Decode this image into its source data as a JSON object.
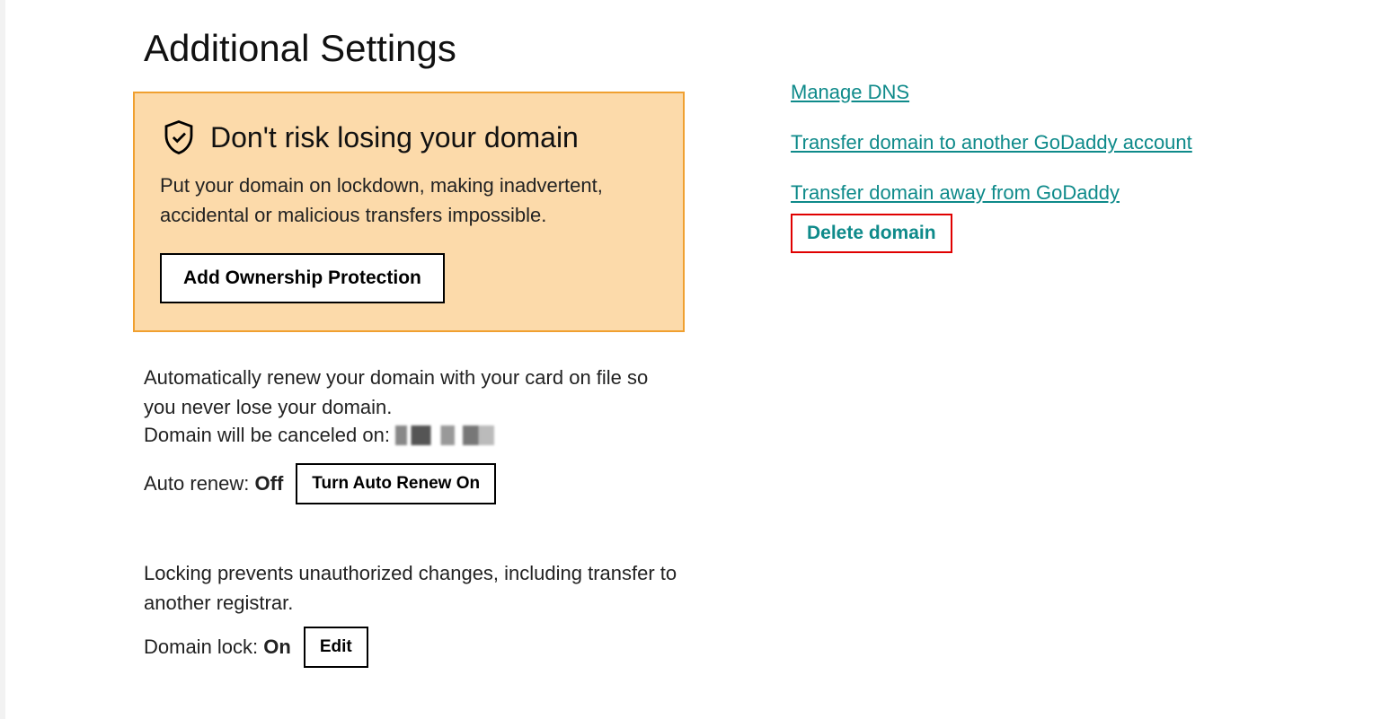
{
  "page": {
    "title": "Additional Settings"
  },
  "warning": {
    "title": "Don't risk losing your domain",
    "desc": "Put your domain on lockdown, making inadvertent, accidental or malicious transfers impossible.",
    "button": "Add Ownership Protection"
  },
  "autorenew": {
    "desc": "Automatically renew your domain with your card on file so you never lose your domain.",
    "cancel_label": "Domain will be canceled on:",
    "row_label": "Auto renew:",
    "row_value": "Off",
    "button": "Turn Auto Renew On"
  },
  "lock": {
    "desc": "Locking prevents unauthorized changes, including transfer to another registrar.",
    "row_label": "Domain lock:",
    "row_value": "On",
    "button": "Edit"
  },
  "links": {
    "manage_dns": "Manage DNS",
    "transfer_account": "Transfer domain to another GoDaddy account",
    "transfer_away": "Transfer domain away from GoDaddy",
    "delete": "Delete domain"
  },
  "colors": {
    "link": "#0e8a8a",
    "warning_border": "#f0a030",
    "warning_bg": "#fcdaaa",
    "highlight_border": "#e00000"
  }
}
